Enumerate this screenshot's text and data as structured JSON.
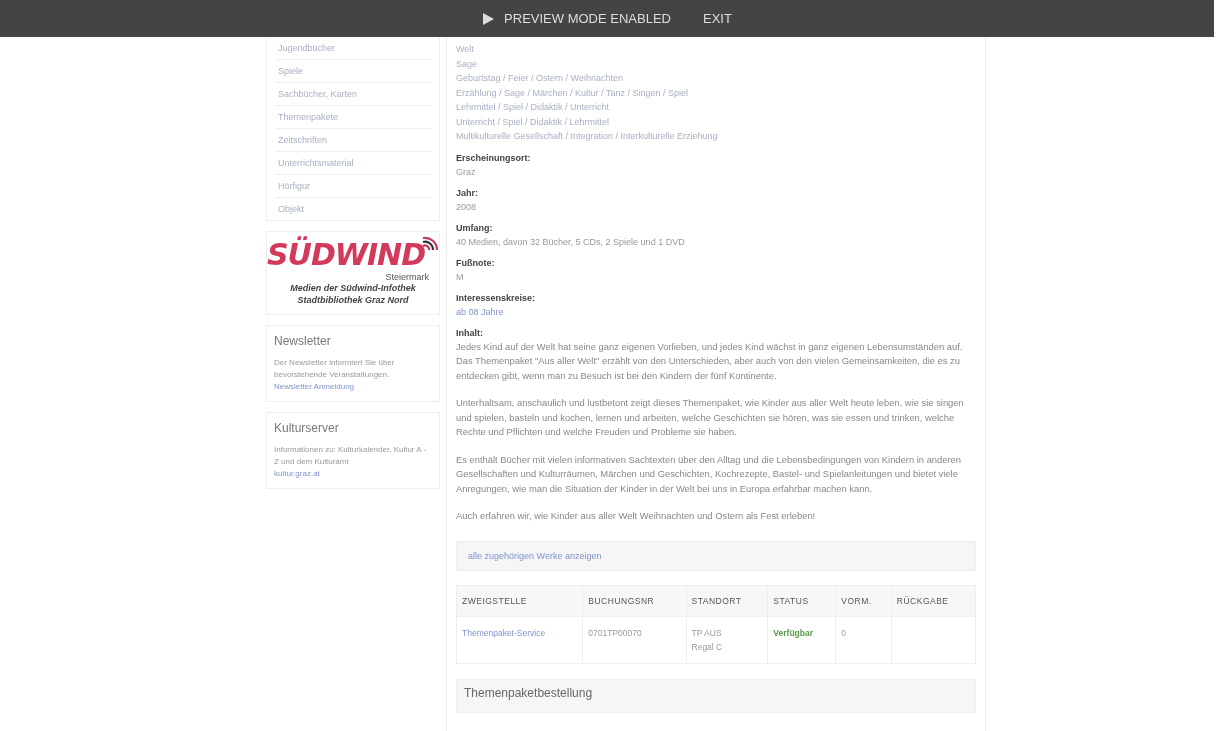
{
  "preview_bar": {
    "label": "PREVIEW MODE ENABLED",
    "exit": "EXIT"
  },
  "sidebar": {
    "categories": [
      "Jugendbücher",
      "Spiele",
      "Sachbücher, Karten",
      "Themenpakete",
      "Zeitschriften",
      "Unterrichtsmaterial",
      "Hörfigur",
      "Objekt"
    ],
    "logo": {
      "name": "SÜDWIND",
      "region": "Steiermark",
      "caption_lines": [
        "Medien der Südwind-Infothek",
        "Stadtbibliothek Graz Nord"
      ]
    },
    "boxes": [
      {
        "title": "Newsletter",
        "text": "Der Newsletter informiert Sie über bevorstehende Veranstaltungen.",
        "link": "Newsletter Anmeldung"
      },
      {
        "title": "Kulturserver",
        "text": "Informationen zu: Kulturkalender, Kultur A - Z und dem Kulturamt",
        "link": "kultur.graz.at"
      }
    ]
  },
  "detail": {
    "keywords": [
      "Welt",
      "Sage",
      "Geburtstag / Feier / Ostern / Weihnachten",
      "Erzählung / Sage / Märchen / Kultur / Tanz / Singen / Spiel",
      "Lehrmittel / Spiel / Didaktik / Unterricht",
      "Unterricht / Spiel / Didaktik / Lehrmittel",
      "Multikulturelle Gesellschaft / Integration / Interkulturelle Erziehung"
    ],
    "fields": [
      {
        "label": "Erscheinungsort:",
        "value": "Graz",
        "kind": "text"
      },
      {
        "label": "Jahr:",
        "value": "2008",
        "kind": "text"
      },
      {
        "label": "Umfang:",
        "value": "40 Medien, davon 32 Bücher, 5 CDs, 2 Spiele und 1 DVD",
        "kind": "text"
      },
      {
        "label": "Fußnote:",
        "value": "M",
        "kind": "text"
      },
      {
        "label": "Interessenskreise:",
        "value": "ab 08 Jahre",
        "kind": "link"
      }
    ],
    "content_label": "Inhalt:",
    "paragraphs": [
      "Jedes Kind auf der Welt hat seine ganz eigenen Vorlieben, und jedes Kind wächst in ganz eigenen Lebensumständen auf. Das Themenpaket \"Aus aller Welt\" erzählt von den Unterschieden, aber auch von den vielen Gemeinsamkeiten, die es zu entdecken gibt, wenn man zu Besuch ist bei den Kindern der fünf Kontinente.",
      "Unterhaltsam, anschaulich und lustbetont zeigt dieses Themenpaket, wie Kinder aus aller Welt heute leben, wie sie singen und spielen, basteln und kochen, lernen und arbeiten, welche Geschichten sie hören, was sie essen und trinken, welche Rechte und Pflichten und welche Freuden und Probleme sie haben.",
      "Es enthält Bücher mit vielen informativen Sachtexten über den Alltag und die Lebensbedingungen von Kindern in anderen Gesellschaften und Kulturräumen, Märchen und Geschichten, Kochrezepte, Bastel- und Spielanleitungen und bietet viele Anregungen, wie man die Situation der Kinder in der Welt bei uns in Europa erfahrbar machen kann.",
      "Auch erfahren wir, wie Kinder aus aller Welt Weihnachten und Ostern als Fest erleben!"
    ],
    "related_link": "alle zugehörigen Werke anzeigen",
    "table": {
      "columns": [
        "ZWEIGSTELLE",
        "BUCHUNGSNR",
        "STANDORT",
        "STATUS",
        "VORM.",
        "RÜCKGABE"
      ],
      "rows": [
        {
          "branch": "Themenpaket-Service",
          "number": "0701TP00070",
          "location": [
            "TP AUS",
            "Regal C"
          ],
          "status": "Verfügbar",
          "reservations": "0"
        }
      ]
    },
    "order_panel": "Themenpaketbestellung"
  }
}
